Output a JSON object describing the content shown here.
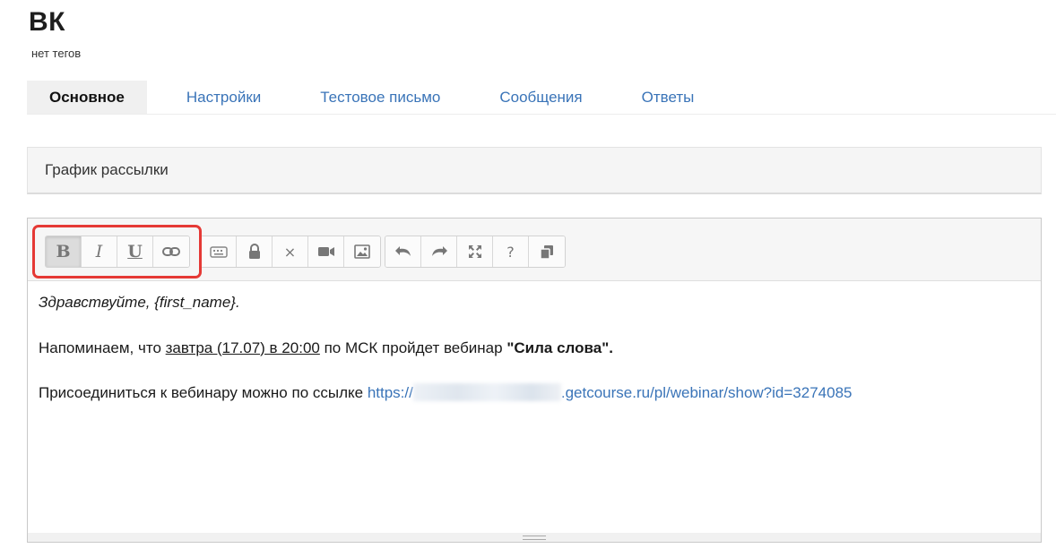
{
  "page": {
    "title": "ВК",
    "tags": "нет тегов"
  },
  "tabs": [
    {
      "label": "Основное",
      "active": true
    },
    {
      "label": "Настройки",
      "active": false
    },
    {
      "label": "Тестовое письмо",
      "active": false
    },
    {
      "label": "Сообщения",
      "active": false
    },
    {
      "label": "Ответы",
      "active": false
    }
  ],
  "section": {
    "title": "График рассылки"
  },
  "toolbar": {
    "group1": [
      {
        "icon": "bold-icon",
        "glyph": "B"
      },
      {
        "icon": "italic-icon",
        "glyph": "I"
      },
      {
        "icon": "underline-icon",
        "glyph": "U"
      },
      {
        "icon": "link-icon"
      }
    ],
    "group2": [
      {
        "icon": "keyboard-icon"
      },
      {
        "icon": "lock-icon"
      },
      {
        "icon": "clear-format-icon",
        "glyph": "×"
      },
      {
        "icon": "video-icon"
      },
      {
        "icon": "image-icon"
      }
    ],
    "group3": [
      {
        "icon": "undo-icon"
      },
      {
        "icon": "redo-icon"
      },
      {
        "icon": "fullscreen-icon"
      },
      {
        "icon": "help-icon",
        "glyph": "?"
      },
      {
        "icon": "copy-icon"
      }
    ]
  },
  "content": {
    "greeting": "Здравствуйте, {first_name}.",
    "reminder_prefix": "Напоминаем, что ",
    "reminder_date": "завтра (17.07) в 20:00",
    "reminder_mid": " по МСК пройдет вебинар ",
    "reminder_title": "\"Сила слова\".",
    "join_prefix": "Присоединиться к вебинару можно по ссылке ",
    "link_start": "https://",
    "link_end": ".getcourse.ru/pl/webinar/show?id=3274085"
  },
  "colors": {
    "accent": "#3a74b8",
    "highlight": "#e53935"
  }
}
